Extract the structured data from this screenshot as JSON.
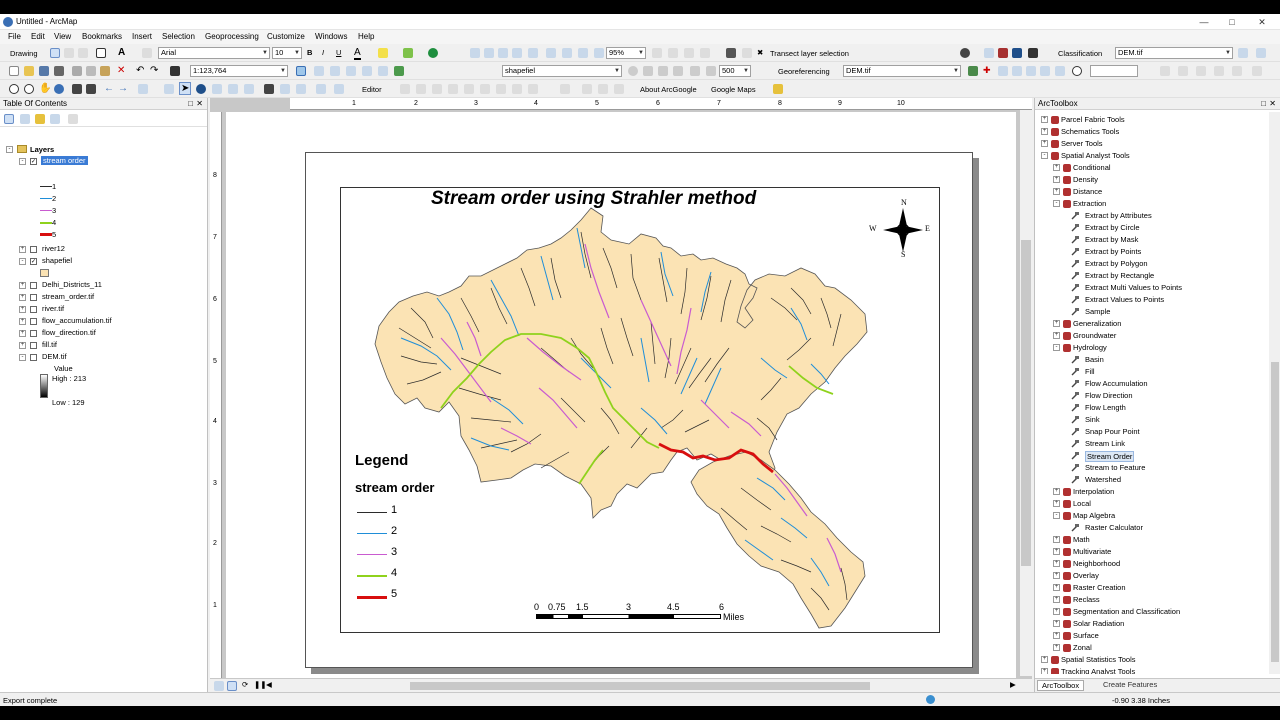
{
  "window": {
    "title": "Untitled - ArcMap"
  },
  "menus": [
    "File",
    "Edit",
    "View",
    "Bookmarks",
    "Insert",
    "Selection",
    "Geoprocessing",
    "Customize",
    "Windows",
    "Help"
  ],
  "toolbar1": {
    "drawing": "Drawing",
    "font_name": "Arial",
    "font_size": "10",
    "bold": "B",
    "italic": "I",
    "underline": "U",
    "zoom_pct": "95%",
    "transect": "Transect layer selection",
    "classification": "Classification",
    "layer_select": "DEM.tif"
  },
  "toolbar2": {
    "scale": "1:123,764",
    "layer_target": "shapefiel",
    "resolution": "500",
    "georef": "Georeferencing",
    "georef_layer": "DEM.tif"
  },
  "toolbar3": {
    "editor": "Editor",
    "about_google": "About ArcGoogle",
    "google_maps": "Google Maps"
  },
  "toc": {
    "title": "Table Of Contents",
    "root": "Layers",
    "stream_layer": "stream order",
    "stream_classes": [
      "1",
      "2",
      "3",
      "4",
      "5"
    ],
    "layers": [
      "river12",
      "shapefiel",
      "Delhi_Districts_11",
      "stream_order.tif",
      "river.tif",
      "flow_accumulation.tif",
      "flow_direction.tif",
      "fill.tif",
      "DEM.tif"
    ],
    "dem_value": "Value",
    "dem_high": "High : 213",
    "dem_low": "Low : 129"
  },
  "layout": {
    "ruler_h": [
      "1",
      "2",
      "3",
      "4",
      "5",
      "6",
      "7",
      "8",
      "9",
      "10"
    ],
    "ruler_v": [
      "8",
      "7",
      "6",
      "5",
      "4",
      "3",
      "2",
      "1"
    ],
    "map_title": "Stream order using Strahler method",
    "north": {
      "n": "N",
      "s": "S",
      "e": "E",
      "w": "W"
    },
    "legend_title": "Legend",
    "legend_subtitle": "stream order",
    "legend_items": [
      "1",
      "2",
      "3",
      "4",
      "5"
    ],
    "scale_labels": [
      "0",
      "0.75",
      "1.5",
      "3",
      "4.5",
      "6"
    ],
    "scale_unit": "Miles"
  },
  "toolbox": {
    "title": "ArcToolbox",
    "items": [
      {
        "label": "Parcel Fabric Tools",
        "level": 0,
        "kind": "box",
        "exp": "+"
      },
      {
        "label": "Schematics Tools",
        "level": 0,
        "kind": "box",
        "exp": "+"
      },
      {
        "label": "Server Tools",
        "level": 0,
        "kind": "box",
        "exp": "+"
      },
      {
        "label": "Spatial Analyst Tools",
        "level": 0,
        "kind": "box",
        "exp": "-"
      },
      {
        "label": "Conditional",
        "level": 1,
        "kind": "box",
        "exp": "+"
      },
      {
        "label": "Density",
        "level": 1,
        "kind": "box",
        "exp": "+"
      },
      {
        "label": "Distance",
        "level": 1,
        "kind": "box",
        "exp": "+"
      },
      {
        "label": "Extraction",
        "level": 1,
        "kind": "box",
        "exp": "-"
      },
      {
        "label": "Extract by Attributes",
        "level": 2,
        "kind": "tool"
      },
      {
        "label": "Extract by Circle",
        "level": 2,
        "kind": "tool"
      },
      {
        "label": "Extract by Mask",
        "level": 2,
        "kind": "tool"
      },
      {
        "label": "Extract by Points",
        "level": 2,
        "kind": "tool"
      },
      {
        "label": "Extract by Polygon",
        "level": 2,
        "kind": "tool"
      },
      {
        "label": "Extract by Rectangle",
        "level": 2,
        "kind": "tool"
      },
      {
        "label": "Extract Multi Values to Points",
        "level": 2,
        "kind": "tool"
      },
      {
        "label": "Extract Values to Points",
        "level": 2,
        "kind": "tool"
      },
      {
        "label": "Sample",
        "level": 2,
        "kind": "tool"
      },
      {
        "label": "Generalization",
        "level": 1,
        "kind": "box",
        "exp": "+"
      },
      {
        "label": "Groundwater",
        "level": 1,
        "kind": "box",
        "exp": "+"
      },
      {
        "label": "Hydrology",
        "level": 1,
        "kind": "box",
        "exp": "-"
      },
      {
        "label": "Basin",
        "level": 2,
        "kind": "tool"
      },
      {
        "label": "Fill",
        "level": 2,
        "kind": "tool"
      },
      {
        "label": "Flow Accumulation",
        "level": 2,
        "kind": "tool"
      },
      {
        "label": "Flow Direction",
        "level": 2,
        "kind": "tool"
      },
      {
        "label": "Flow Length",
        "level": 2,
        "kind": "tool"
      },
      {
        "label": "Sink",
        "level": 2,
        "kind": "tool"
      },
      {
        "label": "Snap Pour Point",
        "level": 2,
        "kind": "tool"
      },
      {
        "label": "Stream Link",
        "level": 2,
        "kind": "tool"
      },
      {
        "label": "Stream Order",
        "level": 2,
        "kind": "tool",
        "selected": true
      },
      {
        "label": "Stream to Feature",
        "level": 2,
        "kind": "tool"
      },
      {
        "label": "Watershed",
        "level": 2,
        "kind": "tool"
      },
      {
        "label": "Interpolation",
        "level": 1,
        "kind": "box",
        "exp": "+"
      },
      {
        "label": "Local",
        "level": 1,
        "kind": "box",
        "exp": "+"
      },
      {
        "label": "Map Algebra",
        "level": 1,
        "kind": "box",
        "exp": "-"
      },
      {
        "label": "Raster Calculator",
        "level": 2,
        "kind": "tool"
      },
      {
        "label": "Math",
        "level": 1,
        "kind": "box",
        "exp": "+"
      },
      {
        "label": "Multivariate",
        "level": 1,
        "kind": "box",
        "exp": "+"
      },
      {
        "label": "Neighborhood",
        "level": 1,
        "kind": "box",
        "exp": "+"
      },
      {
        "label": "Overlay",
        "level": 1,
        "kind": "box",
        "exp": "+"
      },
      {
        "label": "Raster Creation",
        "level": 1,
        "kind": "box",
        "exp": "+"
      },
      {
        "label": "Reclass",
        "level": 1,
        "kind": "box",
        "exp": "+"
      },
      {
        "label": "Segmentation and Classification",
        "level": 1,
        "kind": "box",
        "exp": "+"
      },
      {
        "label": "Solar Radiation",
        "level": 1,
        "kind": "box",
        "exp": "+"
      },
      {
        "label": "Surface",
        "level": 1,
        "kind": "box",
        "exp": "+"
      },
      {
        "label": "Zonal",
        "level": 1,
        "kind": "box",
        "exp": "+"
      },
      {
        "label": "Spatial Statistics Tools",
        "level": 0,
        "kind": "box",
        "exp": "+"
      },
      {
        "label": "Tracking Analyst Tools",
        "level": 0,
        "kind": "box",
        "exp": "+"
      }
    ],
    "tab_toolbox": "ArcToolbox",
    "tab_create": "Create Features"
  },
  "status": {
    "message": "Export complete",
    "coords": "-0.90  3.38 Inches"
  },
  "colors": {
    "basin_fill": "#fbe3b4",
    "order1": "#2b2b2b",
    "order2": "#1f8ed8",
    "order3": "#c95bd0",
    "order4": "#8fd21c",
    "order5": "#d80f0f"
  }
}
